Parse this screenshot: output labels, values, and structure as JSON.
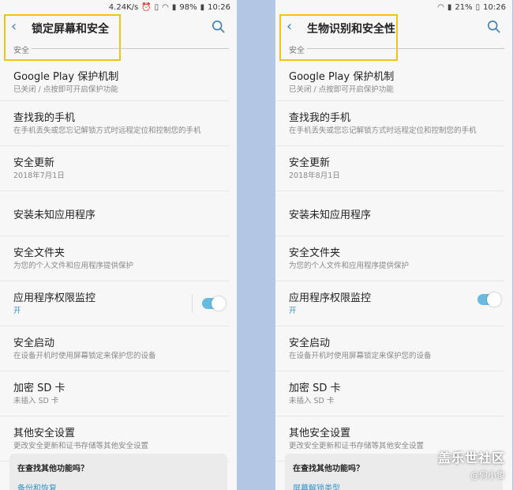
{
  "left": {
    "status": {
      "speed": "4.24K/s",
      "battery": "98%",
      "time": "10:26"
    },
    "title": "锁定屏幕和安全",
    "section": "安全",
    "items": [
      {
        "title": "Google Play 保护机制",
        "subtitle": "已关闭 / 点按即可开启保护功能"
      },
      {
        "title": "查找我的手机",
        "subtitle": "在手机丢失或您忘记解锁方式时远程定位和控制您的手机"
      },
      {
        "title": "安全更新",
        "subtitle": "2018年7月1日"
      },
      {
        "title": "安装未知应用程序",
        "subtitle": ""
      },
      {
        "title": "安全文件夹",
        "subtitle": "为您的个人文件和应用程序提供保护"
      },
      {
        "title": "应用程序权限监控",
        "subtitle": "开"
      },
      {
        "title": "安全启动",
        "subtitle": "在设备开机时使用屏幕锁定来保护您的设备"
      },
      {
        "title": "加密 SD 卡",
        "subtitle": "未插入 SD 卡"
      },
      {
        "title": "其他安全设置",
        "subtitle": "更改安全更新和证书存储等其他安全设置"
      }
    ],
    "card": {
      "title": "在查找其他功能吗？",
      "link": "备份和恢复"
    }
  },
  "right": {
    "status": {
      "battery": "21%",
      "time": "10:26"
    },
    "title": "生物识别和安全性",
    "section": "安全",
    "items": [
      {
        "title": "Google Play 保护机制",
        "subtitle": "已关闭 / 点按即可开启保护功能"
      },
      {
        "title": "查找我的手机",
        "subtitle": "在手机丢失或您忘记解锁方式时远程定位和控制您的手机"
      },
      {
        "title": "安全更新",
        "subtitle": "2018年8月1日"
      },
      {
        "title": "安装未知应用程序",
        "subtitle": ""
      },
      {
        "title": "安全文件夹",
        "subtitle": "为您的个人文件和应用程序提供保护"
      },
      {
        "title": "应用程序权限监控",
        "subtitle": "开"
      },
      {
        "title": "安全启动",
        "subtitle": "在设备开机时使用屏幕锁定来保护您的设备"
      },
      {
        "title": "加密 SD 卡",
        "subtitle": "未插入 SD 卡"
      },
      {
        "title": "其他安全设置",
        "subtitle": "更改安全更新和证书存储等其他安全设置"
      }
    ],
    "card": {
      "title": "在查找其他功能吗？",
      "link": "屏幕解锁类型"
    }
  },
  "watermark": {
    "brand": "盖乐世社区",
    "author": "@何小俊"
  },
  "colors": {
    "accent": "#2f95c9",
    "highlight": "#f1c40f",
    "background": "#b3c6e4"
  },
  "icons": {
    "back": "chevron-left-icon",
    "search": "search-icon",
    "toggle": "toggle-switch"
  }
}
